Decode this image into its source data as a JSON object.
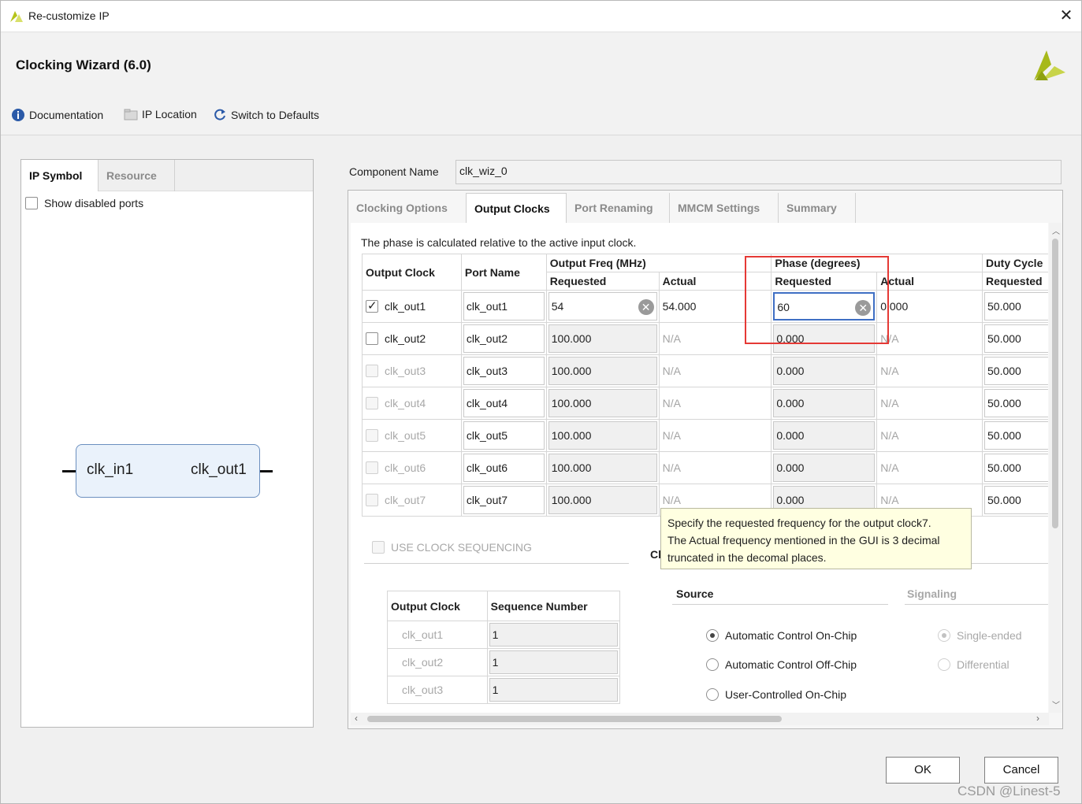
{
  "window": {
    "title": "Re-customize IP",
    "close": "✕"
  },
  "header": {
    "wizard_title": "Clocking Wizard (6.0)"
  },
  "toolbar": {
    "documentation": "Documentation",
    "ip_location": "IP Location",
    "switch_defaults": "Switch to Defaults"
  },
  "left": {
    "tabs": [
      "IP Symbol",
      "Resource"
    ],
    "show_disabled_ports": "Show disabled ports",
    "block": {
      "input": "clk_in1",
      "output": "clk_out1"
    }
  },
  "component": {
    "label": "Component Name",
    "value": "clk_wiz_0"
  },
  "tabs": [
    "Clocking Options",
    "Output Clocks",
    "Port Renaming",
    "MMCM Settings",
    "Summary"
  ],
  "output_clocks": {
    "note": "The phase is calculated relative to the active input clock.",
    "headers": {
      "output_clock": "Output Clock",
      "port_name": "Port Name",
      "output_freq": "Output Freq (MHz)",
      "phase": "Phase (degrees)",
      "duty": "Duty Cycle",
      "requested": "Requested",
      "actual": "Actual"
    },
    "rows": [
      {
        "clock": "clk_out1",
        "port": "clk_out1",
        "freq_req": "54",
        "freq_act": "54.000",
        "phase_req": "60",
        "phase_act": "0.000",
        "duty_req": "50.000"
      },
      {
        "clock": "clk_out2",
        "port": "clk_out2",
        "freq_req": "100.000",
        "freq_act": "N/A",
        "phase_req": "0.000",
        "phase_act": "N/A",
        "duty_req": "50.000"
      },
      {
        "clock": "clk_out3",
        "port": "clk_out3",
        "freq_req": "100.000",
        "freq_act": "N/A",
        "phase_req": "0.000",
        "phase_act": "N/A",
        "duty_req": "50.000"
      },
      {
        "clock": "clk_out4",
        "port": "clk_out4",
        "freq_req": "100.000",
        "freq_act": "N/A",
        "phase_req": "0.000",
        "phase_act": "N/A",
        "duty_req": "50.000"
      },
      {
        "clock": "clk_out5",
        "port": "clk_out5",
        "freq_req": "100.000",
        "freq_act": "N/A",
        "phase_req": "0.000",
        "phase_act": "N/A",
        "duty_req": "50.000"
      },
      {
        "clock": "clk_out6",
        "port": "clk_out6",
        "freq_req": "100.000",
        "freq_act": "N/A",
        "phase_req": "0.000",
        "phase_act": "N/A",
        "duty_req": "50.000"
      },
      {
        "clock": "clk_out7",
        "port": "clk_out7",
        "freq_req": "100.000",
        "freq_act": "N/A",
        "phase_req": "0.000",
        "phase_act": "N/A",
        "duty_req": "50.000"
      }
    ],
    "use_clock_sequencing": "USE CLOCK SEQUENCING",
    "seq_headers": {
      "clock": "Output Clock",
      "seq": "Sequence Number"
    },
    "seq_rows": [
      {
        "clock": "clk_out1",
        "seq": "1"
      },
      {
        "clock": "clk_out2",
        "seq": "1"
      },
      {
        "clock": "clk_out3",
        "seq": "1"
      }
    ],
    "clipped_label": "Cl",
    "source": {
      "title": "Source",
      "options": [
        "Automatic Control On-Chip",
        "Automatic Control Off-Chip",
        "User-Controlled On-Chip"
      ]
    },
    "signaling": {
      "title": "Signaling",
      "options": [
        "Single-ended",
        "Differential"
      ]
    }
  },
  "tooltip": "Specify the requested frequency for the output clock7.\nThe Actual frequency mentioned in the GUI is 3 decimal\ntruncated in the decomal places.",
  "buttons": {
    "ok": "OK",
    "cancel": "Cancel"
  },
  "watermark": "CSDN @Linest-5",
  "colors": {
    "highlight_box": "#e53935",
    "focus_border": "#3f6fc4",
    "tooltip_bg": "#ffffe1",
    "logo": "#b5c31a"
  }
}
